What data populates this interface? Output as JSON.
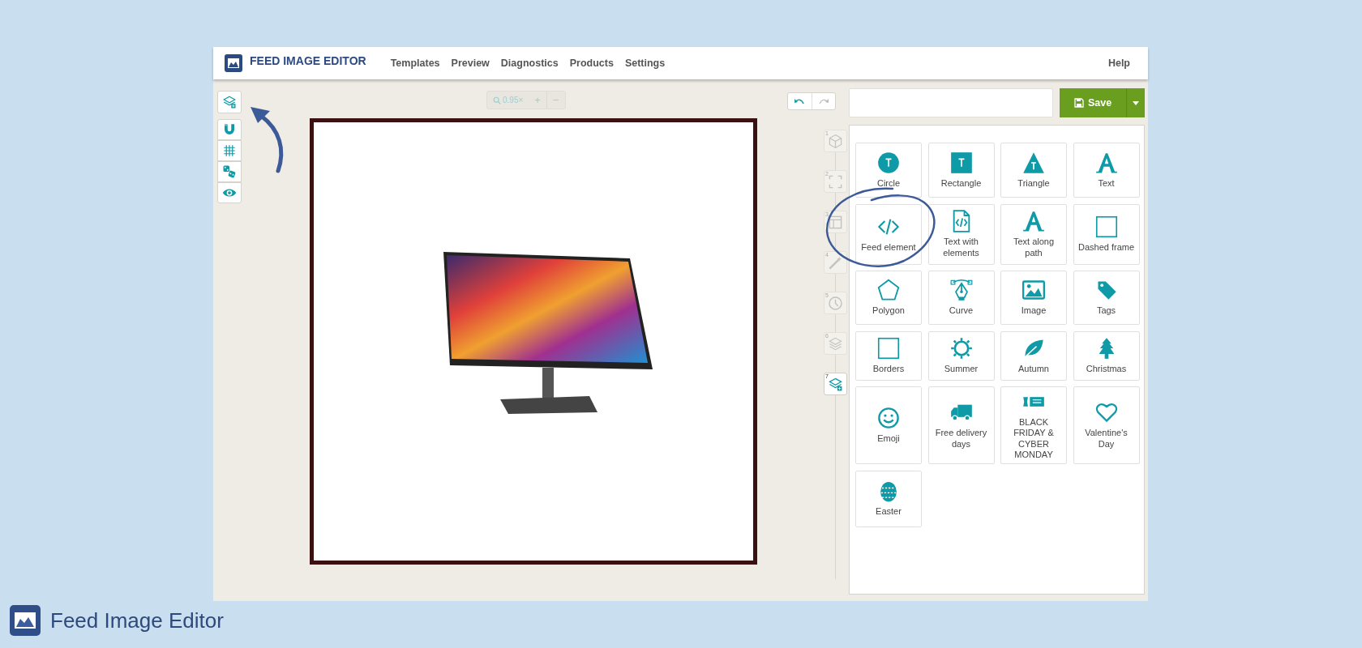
{
  "header": {
    "title": "FEED IMAGE EDITOR",
    "nav": [
      {
        "label": "Templates"
      },
      {
        "label": "Preview"
      },
      {
        "label": "Diagnostics"
      },
      {
        "label": "Products"
      },
      {
        "label": "Settings"
      }
    ],
    "help": "Help"
  },
  "tools": [
    {
      "kind": "layers-add"
    },
    {
      "kind": "magnet"
    },
    {
      "kind": "grid"
    },
    {
      "kind": "dice"
    },
    {
      "kind": "eye"
    }
  ],
  "zoom": {
    "reading": "0.95×",
    "zoom_in": "+",
    "zoom_out": "−"
  },
  "steps": [
    {
      "number": "1",
      "kind": "cube",
      "selected": false
    },
    {
      "number": "2",
      "kind": "corners",
      "selected": false
    },
    {
      "number": "3",
      "kind": "window",
      "selected": false
    },
    {
      "number": "4",
      "kind": "wand",
      "selected": false
    },
    {
      "number": "5",
      "kind": "clock",
      "selected": false
    },
    {
      "number": "6",
      "kind": "layers",
      "selected": false
    },
    {
      "number": "7",
      "kind": "layers-add",
      "selected": true
    }
  ],
  "save": {
    "label": "Save"
  },
  "elements": [
    {
      "label": "Circle",
      "kind": "circle"
    },
    {
      "label": "Rectangle",
      "kind": "rectangle"
    },
    {
      "label": "Triangle",
      "kind": "triangle"
    },
    {
      "label": "Text",
      "kind": "text"
    },
    {
      "label": "Feed element",
      "kind": "code"
    },
    {
      "label": "Text with elements",
      "kind": "code-file"
    },
    {
      "label": "Text along path",
      "kind": "text"
    },
    {
      "label": "Dashed frame",
      "kind": "square"
    },
    {
      "label": "Polygon",
      "kind": "pentagon"
    },
    {
      "label": "Curve",
      "kind": "pen"
    },
    {
      "label": "Image",
      "kind": "image"
    },
    {
      "label": "Tags",
      "kind": "tag"
    },
    {
      "label": "Borders",
      "kind": "square"
    },
    {
      "label": "Summer",
      "kind": "sun"
    },
    {
      "label": "Autumn",
      "kind": "leaf"
    },
    {
      "label": "Christmas",
      "kind": "tree"
    },
    {
      "label": "Emoji",
      "kind": "smiley"
    },
    {
      "label": "Free delivery days",
      "kind": "truck"
    },
    {
      "label": "BLACK FRIDAY & CYBER MONDAY",
      "kind": "banner"
    },
    {
      "label": "Valentine's Day",
      "kind": "heart"
    },
    {
      "label": "Easter",
      "kind": "egg"
    }
  ],
  "footer": {
    "brand": "Feed Image Editor"
  }
}
